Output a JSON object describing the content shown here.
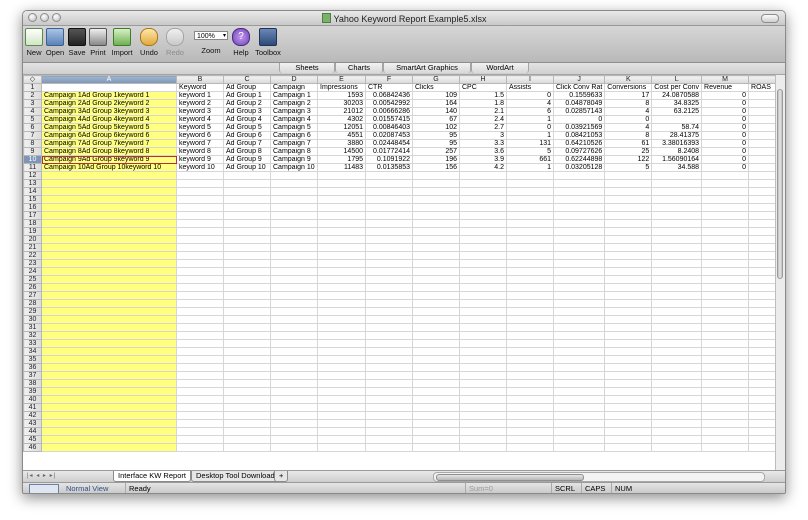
{
  "window": {
    "title": "Yahoo Keyword Report Example5.xlsx"
  },
  "toolbar": {
    "items": [
      {
        "label": "New",
        "icon": "new-document-icon"
      },
      {
        "label": "Open",
        "icon": "open-folder-icon"
      },
      {
        "label": "Save",
        "icon": "save-disk-icon"
      },
      {
        "label": "Print",
        "icon": "printer-icon"
      },
      {
        "label": "Import",
        "icon": "import-icon"
      },
      {
        "label": "Undo",
        "icon": "undo-icon"
      },
      {
        "label": "Redo",
        "icon": "redo-icon"
      },
      {
        "label": "Zoom",
        "icon": "zoom-field"
      },
      {
        "label": "Help",
        "icon": "help-icon"
      },
      {
        "label": "Toolbox",
        "icon": "toolbox-icon"
      }
    ],
    "zoom_value": "100%"
  },
  "ribbon": {
    "tabs": [
      "Sheets",
      "Charts",
      "SmartArt Graphics",
      "WordArt"
    ]
  },
  "sheet": {
    "column_letters": [
      "A",
      "B",
      "C",
      "D",
      "E",
      "F",
      "G",
      "H",
      "I",
      "J",
      "K",
      "L",
      "M",
      ""
    ],
    "selected_column": "A",
    "selected_row": 10,
    "row_count": 46,
    "headers": [
      "",
      "Keyword",
      "Ad Group",
      "Campaign",
      "Impressions",
      "CTR",
      "Clicks",
      "CPC",
      "Assists",
      "Click Conv Rat",
      "Conversions",
      "Cost per Conv",
      "Revenue",
      "ROAS"
    ],
    "rows": [
      [
        "Campaign 1Ad Group 1keyword 1",
        "keyword 1",
        "Ad Group 1",
        "Campaign 1",
        "1593",
        "0.06842436",
        "109",
        "1.5",
        "0",
        "0.1559633",
        "17",
        "24.0870588",
        "0",
        ""
      ],
      [
        "Campaign 2Ad Group 2keyword 2",
        "keyword 2",
        "Ad Group 2",
        "Campaign 2",
        "30203",
        "0.00542992",
        "164",
        "1.8",
        "4",
        "0.04878049",
        "8",
        "34.8325",
        "0",
        ""
      ],
      [
        "Campaign 3Ad Group 3keyword 3",
        "keyword 3",
        "Ad Group 3",
        "Campaign 3",
        "21012",
        "0.00666286",
        "140",
        "2.1",
        "6",
        "0.02857143",
        "4",
        "63.2125",
        "0",
        ""
      ],
      [
        "Campaign 4Ad Group 4keyword 4",
        "keyword 4",
        "Ad Group 4",
        "Campaign 4",
        "4302",
        "0.01557415",
        "67",
        "2.4",
        "1",
        "0",
        "0",
        "",
        "0",
        ""
      ],
      [
        "Campaign 5Ad Group 5keyword 5",
        "keyword 5",
        "Ad Group 5",
        "Campaign 5",
        "12051",
        "0.00846403",
        "102",
        "2.7",
        "0",
        "0.03921569",
        "4",
        "58.74",
        "0",
        ""
      ],
      [
        "Campaign 6Ad Group 6keyword 6",
        "keyword 6",
        "Ad Group 6",
        "Campaign 6",
        "4551",
        "0.02087453",
        "95",
        "3",
        "1",
        "0.08421053",
        "8",
        "28.41375",
        "0",
        ""
      ],
      [
        "Campaign 7Ad Group 7keyword 7",
        "keyword 7",
        "Ad Group 7",
        "Campaign 7",
        "3880",
        "0.02448454",
        "95",
        "3.3",
        "131",
        "0.64210526",
        "61",
        "3.38016393",
        "0",
        ""
      ],
      [
        "Campaign 8Ad Group 8keyword 8",
        "keyword 8",
        "Ad Group 8",
        "Campaign 8",
        "14500",
        "0.01772414",
        "257",
        "3.6",
        "5",
        "0.09727626",
        "25",
        "8.2408",
        "0",
        ""
      ],
      [
        "Campaign 9Ad Group 9keyword 9",
        "keyword 9",
        "Ad Group 9",
        "Campaign 9",
        "1795",
        "0.1091922",
        "196",
        "3.9",
        "661",
        "0.62244898",
        "122",
        "1.56090164",
        "0",
        ""
      ],
      [
        "Campaign 10Ad Group 10keyword 10",
        "keyword 10",
        "Ad Group 10",
        "Campaign 10",
        "11483",
        "0.0135853",
        "156",
        "4.2",
        "1",
        "0.03205128",
        "5",
        "34.588",
        "0",
        ""
      ]
    ]
  },
  "sheet_tabs": [
    "Interface KW Report",
    "Desktop Tool Download",
    "+"
  ],
  "status": {
    "view": "Normal View",
    "state": "Ready",
    "sum": "Sum=0",
    "scrl": "SCRL",
    "caps": "CAPS",
    "num": "NUM"
  }
}
